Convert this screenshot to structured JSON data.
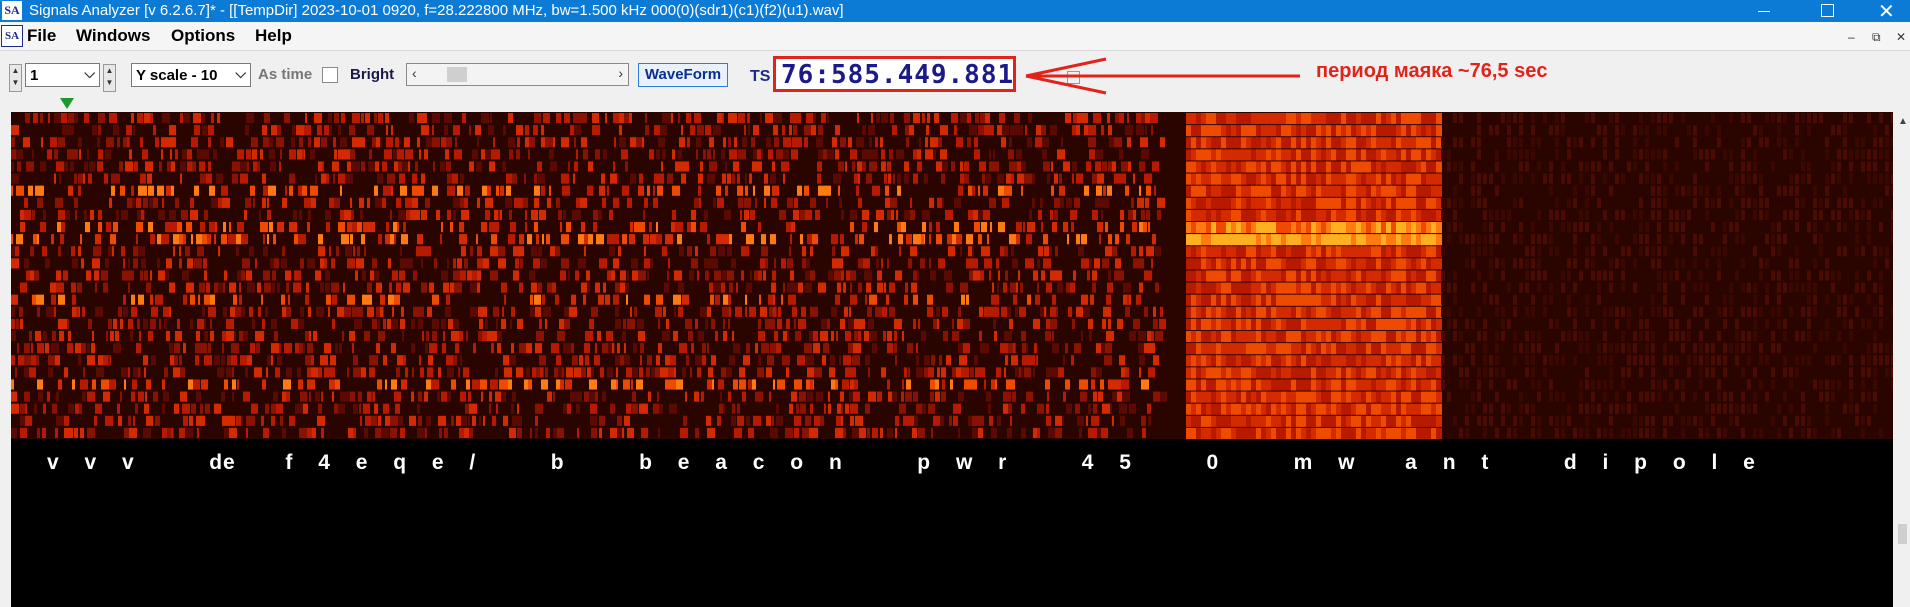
{
  "window": {
    "title": "Signals Analyzer [v 6.2.6.7]* - [[TempDir] 2023-10-01 0920, f=28.222800 MHz, bw=1.500 kHz 000(0)(sdr1)(c1)(f2)(u1).wav]",
    "app_icon": "SA",
    "minimize_label": "",
    "maximize_label": "",
    "close_label": "✕"
  },
  "menu": {
    "icon": "SA",
    "items": [
      "File",
      "Windows",
      "Options",
      "Help"
    ],
    "mdi_controls": [
      "–",
      "⧉",
      "✕"
    ]
  },
  "toolbar": {
    "channel_value": "1",
    "yscale_value": "Y scale - 10",
    "as_time_label": "As time",
    "bright_label": "Bright",
    "bright_checked": false,
    "waveform_label": "WaveForm",
    "ts_label": "TS",
    "ts_value": "76:585.449.881"
  },
  "annotation": {
    "text": "период маяка ~76,5 sec",
    "color": "#e2231a"
  },
  "spectrogram": {
    "decoded_text": "v v v   de  f 4 e q e /   b   b e a c o n   p w r   4 5   0   m w  a n t   d i p o l e"
  },
  "colors": {
    "titlebar": "#0b7bd6",
    "highlight": "#e2231a",
    "marker": "#1a9a2a"
  }
}
